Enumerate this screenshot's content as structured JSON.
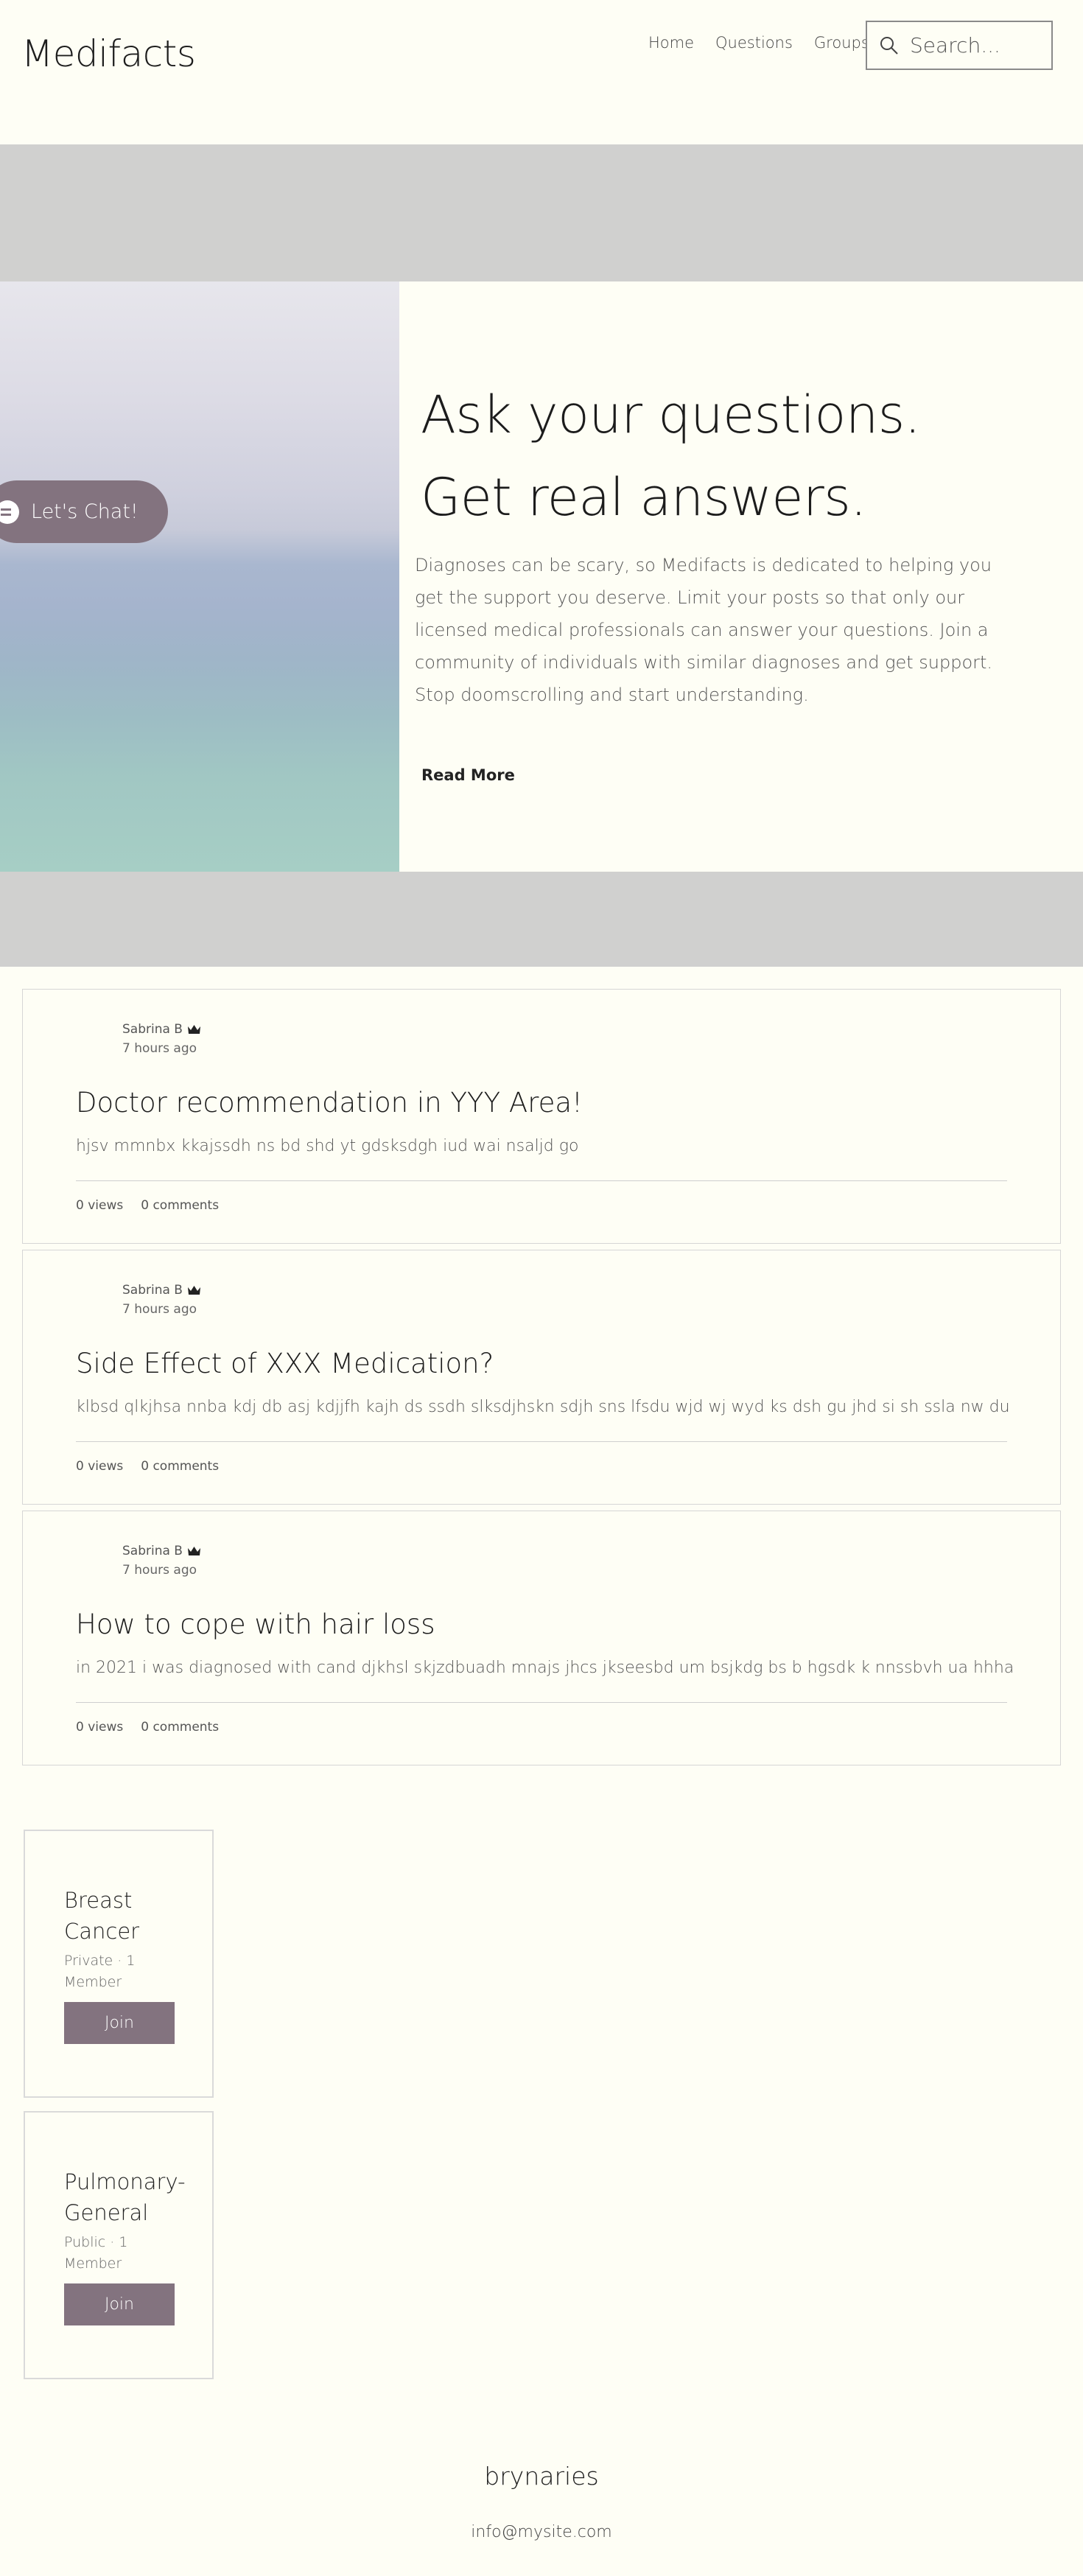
{
  "header": {
    "logo": "Medifacts",
    "nav": [
      {
        "label": "Home"
      },
      {
        "label": "Questions"
      },
      {
        "label": "Groups"
      }
    ],
    "search": {
      "placeholder": "Search..."
    }
  },
  "hero": {
    "chat_label": "Let's Chat!",
    "heading_line1": "Ask your questions.",
    "heading_line2": "Get real answers.",
    "body": "Diagnoses can be scary, so Medifacts is dedicated to helping you get the support you deserve. Limit your posts so that only our licensed medical professionals can answer your questions. Join a community of individuals with similar diagnoses and get support. Stop doomscrolling and start understanding.",
    "read_more": "Read More"
  },
  "posts": [
    {
      "author": "Sabrina B",
      "time": "7 hours ago",
      "title": "Doctor recommendation in YYY Area!",
      "excerpt": "hjsv mmnbx kkajssdh ns bd shd yt gdsksdgh iud wai nsaljd go",
      "views": "0 views",
      "comments": "0 comments"
    },
    {
      "author": "Sabrina B",
      "time": "7 hours ago",
      "title": "Side Effect of XXX Medication?",
      "excerpt": "klbsd qlkjhsa nnba kdj db asj kdjjfh kajh ds ssdh slksdjhskn sdjh sns lfsdu wjd wj wyd ks dsh gu jhd si sh ssla nw du",
      "views": "0 views",
      "comments": "0 comments"
    },
    {
      "author": "Sabrina B",
      "time": "7 hours ago",
      "title": "How to cope with hair loss",
      "excerpt": "in 2021 i was diagnosed with cand djkhsl skjzdbuadh mnajs jhcs jkseesbd um bsjkdg bs b hgsdk k nnssbvh ua hhha",
      "views": "0 views",
      "comments": "0 comments"
    }
  ],
  "groups": [
    {
      "name": "Breast Cancer",
      "meta": "Private · 1 Member",
      "join": "Join"
    },
    {
      "name": "Pulmonary-General",
      "meta": "Public · 1 Member",
      "join": "Join"
    }
  ],
  "footer": {
    "name": "brynaries",
    "email": "info@mysite.com"
  },
  "colors": {
    "background": "#FEFEF5",
    "band": "#D0D0CF",
    "accent": "#83737F"
  }
}
